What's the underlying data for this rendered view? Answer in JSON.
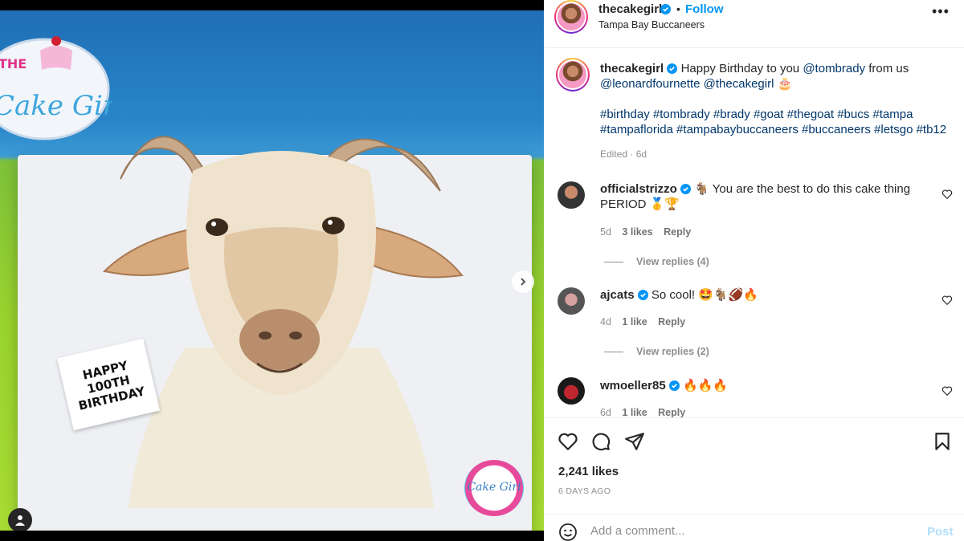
{
  "post": {
    "username": "thecakegirl",
    "follow_label": "Follow",
    "separator": "•",
    "location": "Tampa Bay Buccaneers",
    "more_label": "•••"
  },
  "caption": {
    "username": "thecakegirl",
    "text_before": "Happy Birthday to you ",
    "mention_1": "@tombrady",
    "text_mid": " from us",
    "mention_2": "@leonardfournette",
    "mention_3": "@thecakegirl",
    "emoji": "🎂",
    "hashtags_line1": "#birthday #tombrady #brady #goat #thegoat #bucs #tampa",
    "hashtags_line2": "#tampaflorida #tampabaybuccaneers #buccaneers #letsgo #tb12",
    "edited": "Edited · 6d"
  },
  "comments": [
    {
      "username": "officialstrizzo",
      "text": "🐐 You are the best to do this cake thing PERIOD 🥇🏆",
      "age": "5d",
      "likes": "3 likes",
      "reply_label": "Reply",
      "view_replies": "View replies (4)"
    },
    {
      "username": "ajcats",
      "text": "So cool! 🤩🐐🏈🔥",
      "age": "4d",
      "likes": "1 like",
      "reply_label": "Reply",
      "view_replies": "View replies (2)"
    },
    {
      "username": "wmoeller85",
      "text": "🔥🔥🔥",
      "age": "6d",
      "likes": "1 like",
      "reply_label": "Reply"
    }
  ],
  "engagement": {
    "likes": "2,241 likes",
    "date": "6 DAYS AGO"
  },
  "composer": {
    "placeholder": "Add a comment...",
    "post_label": "Post"
  },
  "photo": {
    "sign_line1": "HAPPY",
    "sign_line2": "100TH",
    "sign_line3": "BIRTHDAY",
    "watermark": "Cake Girl",
    "banner_text": "THE",
    "banner_script": "Cake Girl"
  },
  "icons": {
    "verified": "verified-badge-icon",
    "heart": "heart-icon",
    "comment": "comment-icon",
    "share": "share-icon",
    "save": "bookmark-icon",
    "emoji": "emoji-icon",
    "next": "chevron-right-icon",
    "user_tag": "user-tag-icon"
  },
  "colors": {
    "accent": "#0095f6",
    "link": "#00376b",
    "muted": "#8e8e8e",
    "post_disabled": "#b2dffc"
  }
}
